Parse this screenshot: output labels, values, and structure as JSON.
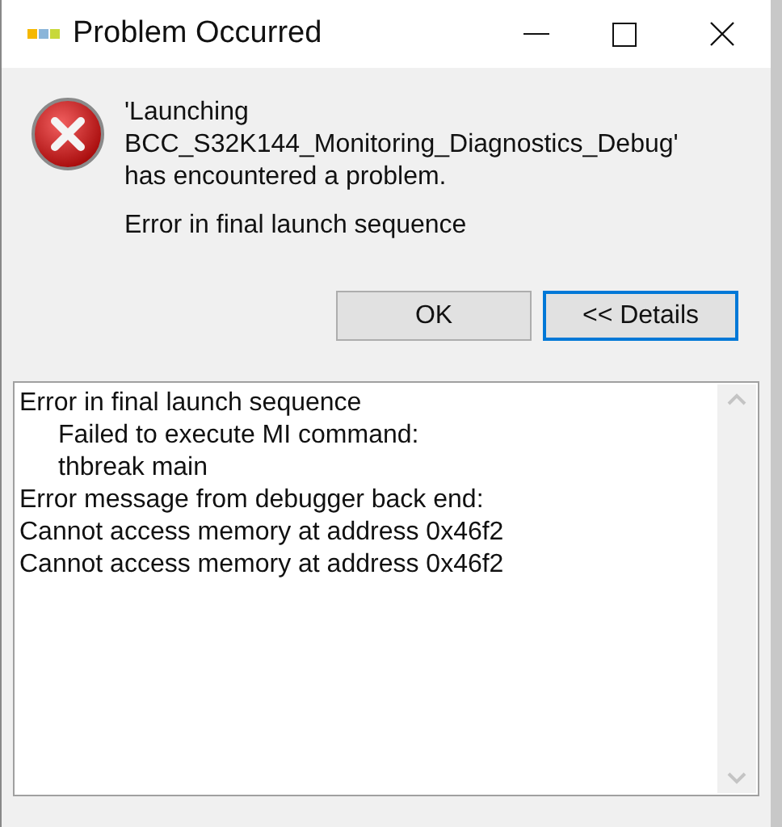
{
  "window": {
    "title": "Problem Occurred"
  },
  "message": {
    "lines": [
      "'Launching",
      "BCC_S32K144_Monitoring_Diagnostics_Debug'",
      "has encountered a problem."
    ],
    "reason": "Error in final launch sequence"
  },
  "buttons": [
    {
      "label": "OK",
      "selected": false
    },
    {
      "label": "<< Details",
      "selected": true
    }
  ],
  "details": [
    {
      "text": "Error in final launch sequence",
      "children": [
        {
          "text": "Failed to execute MI command:"
        },
        {
          "text": "thbreak main"
        }
      ]
    },
    {
      "text": "Error message from debugger back end:"
    },
    {
      "text": "Cannot access memory at address 0x46f2"
    },
    {
      "text": "Cannot access memory at address 0x46f2"
    }
  ]
}
